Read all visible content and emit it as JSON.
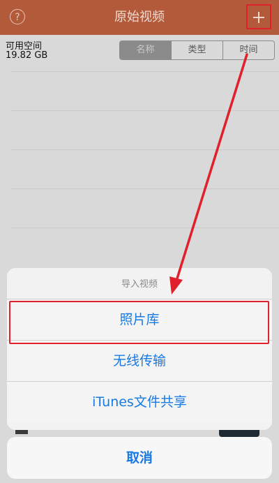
{
  "navbar": {
    "title": "原始视频",
    "help_icon_glyph": "?",
    "add_icon": "plus-icon"
  },
  "storage": {
    "label": "可用空间",
    "value": "19.82 GB"
  },
  "sort": {
    "options": [
      "名称",
      "类型",
      "时间"
    ],
    "selected": "名称"
  },
  "action_sheet": {
    "title": "导入视频",
    "options": [
      "照片库",
      "无线传输",
      "iTunes文件共享"
    ],
    "cancel": "取消"
  },
  "colors": {
    "navbar": "#b35a3a",
    "accent_blue": "#1779e3",
    "annotation_red": "#e0202b"
  }
}
